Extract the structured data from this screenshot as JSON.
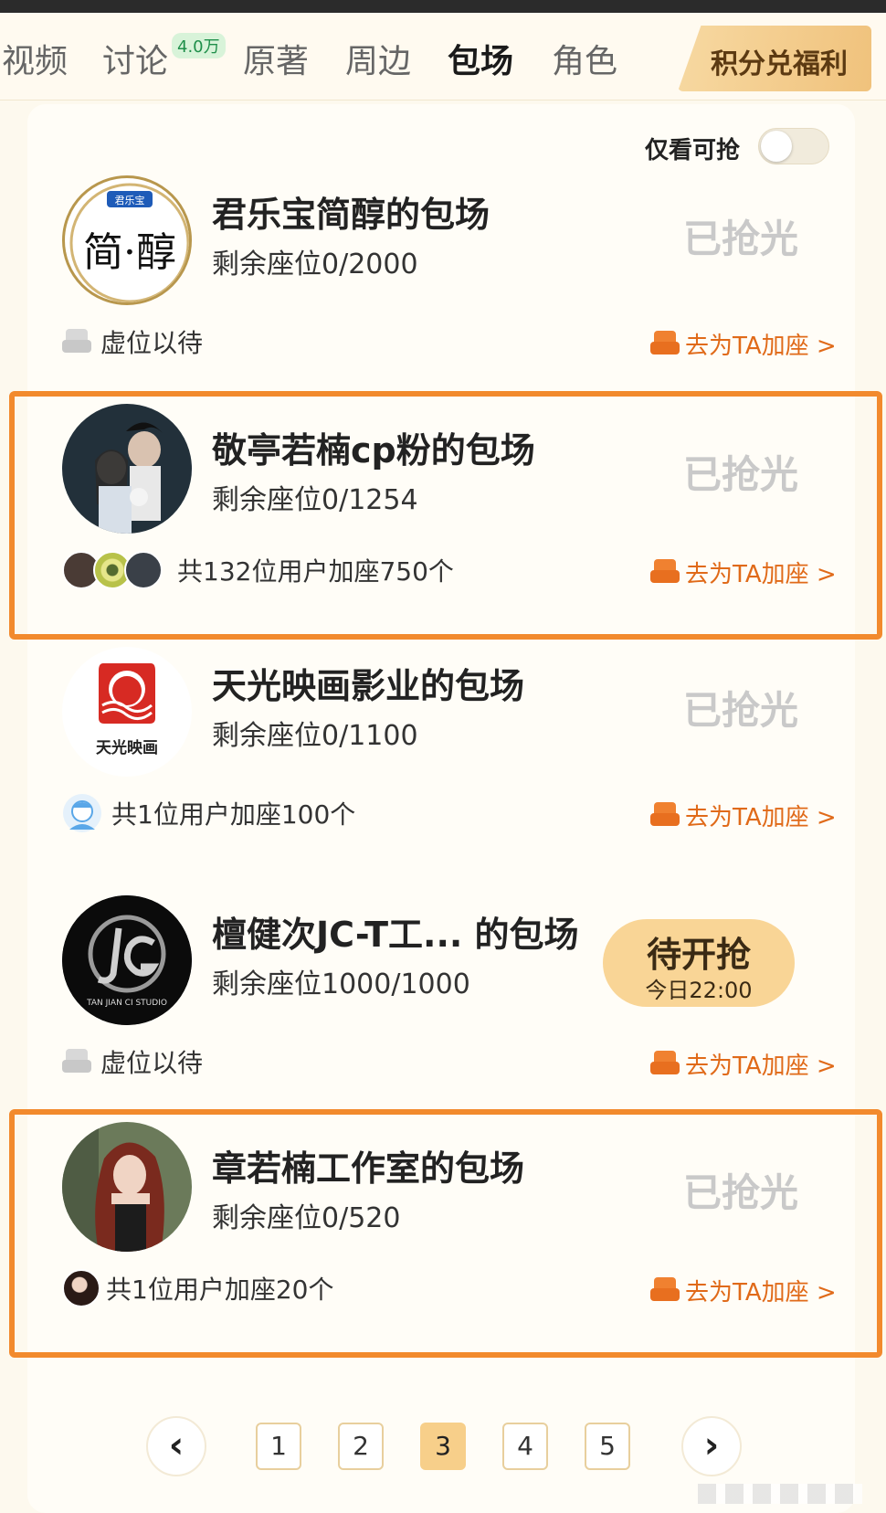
{
  "tabs": [
    {
      "label": "视频"
    },
    {
      "label": "讨论",
      "badge": "4.0万"
    },
    {
      "label": "原著"
    },
    {
      "label": "周边"
    },
    {
      "label": "包场",
      "active": true
    },
    {
      "label": "角色"
    }
  ],
  "rewards_button": "积分兑福利",
  "filter": {
    "label": "仅看可抢",
    "enabled": false
  },
  "cards": [
    {
      "title": "君乐宝简醇的包场",
      "seats": "剩余座位0/2000",
      "status": "已抢光",
      "footer_left": "虚位以待",
      "footer_right": "去为TA加座 >",
      "logo_tag": "君乐宝",
      "logo_text": "简·醇"
    },
    {
      "title": "敬亭若楠cp粉的包场",
      "seats": "剩余座位0/1254",
      "status": "已抢光",
      "footer_left": "共132位用户加座750个",
      "footer_right": "去为TA加座 >"
    },
    {
      "title": "天光映画影业的包场",
      "seats": "剩余座位0/1100",
      "status": "已抢光",
      "footer_left": "共1位用户加座100个",
      "footer_right": "去为TA加座 >",
      "logo_text": "天光映画"
    },
    {
      "title": "檀健次JC-T工...   的包场",
      "seats": "剩余座位1000/1000",
      "status_main": "待开抢",
      "status_sub": "今日22:00",
      "footer_left": "虚位以待",
      "footer_right": "去为TA加座 >",
      "logo_text": "TAN JIAN CI STUDIO"
    },
    {
      "title": "章若楠工作室的包场",
      "seats": "剩余座位0/520",
      "status": "已抢光",
      "footer_left": "共1位用户加座20个",
      "footer_right": "去为TA加座 >"
    }
  ],
  "pagination": {
    "pages": [
      "1",
      "2",
      "3",
      "4",
      "5"
    ],
    "current": "3",
    "prev": "‹",
    "next": "›"
  },
  "colors": {
    "accent": "#f28a2d",
    "gold": "#f7cf8a",
    "background": "#fdf9ee"
  }
}
